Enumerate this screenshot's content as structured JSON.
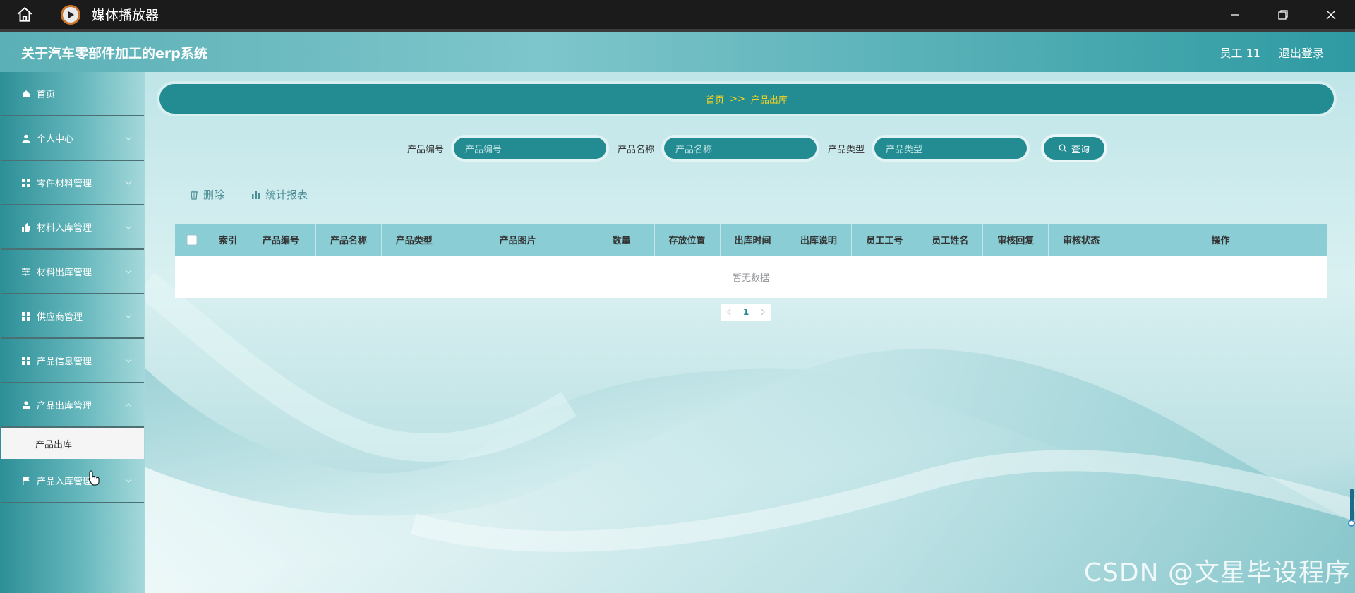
{
  "window": {
    "title": "媒体播放器"
  },
  "header": {
    "title": "关于汽车零部件加工的erp系统",
    "user": "员工 11",
    "logout": "退出登录"
  },
  "sidebar": {
    "items": [
      {
        "label": "首页",
        "icon": "home-icon",
        "has_chevron": false
      },
      {
        "label": "个人中心",
        "icon": "user-icon",
        "has_chevron": true
      },
      {
        "label": "零件材料管理",
        "icon": "grid-icon",
        "has_chevron": true
      },
      {
        "label": "材料入库管理",
        "icon": "thumb-icon",
        "has_chevron": true
      },
      {
        "label": "材料出库管理",
        "icon": "sliders-icon",
        "has_chevron": true
      },
      {
        "label": "供应商管理",
        "icon": "grid-icon",
        "has_chevron": true
      },
      {
        "label": "产品信息管理",
        "icon": "grid-icon",
        "has_chevron": true
      },
      {
        "label": "产品出库管理",
        "icon": "person-icon",
        "has_chevron": true
      },
      {
        "label": "产品入库管理",
        "icon": "flag-icon",
        "has_chevron": true
      }
    ],
    "submenu": {
      "label": "产品出库"
    }
  },
  "breadcrumb": {
    "home": "首页",
    "sep": ">>",
    "current": "产品出库"
  },
  "search": {
    "fields": [
      {
        "label": "产品编号",
        "placeholder": "产品编号"
      },
      {
        "label": "产品名称",
        "placeholder": "产品名称"
      },
      {
        "label": "产品类型",
        "placeholder": "产品类型"
      }
    ],
    "button": "查询"
  },
  "actions": {
    "delete": "删除",
    "report": "统计报表"
  },
  "table": {
    "columns": [
      "索引",
      "产品编号",
      "产品名称",
      "产品类型",
      "产品图片",
      "数量",
      "存放位置",
      "出库时间",
      "出库说明",
      "员工工号",
      "员工姓名",
      "审核回复",
      "审核状态",
      "操作"
    ],
    "empty_text": "暂无数据"
  },
  "pagination": {
    "current": "1"
  },
  "watermark": "CSDN @文星毕设程序",
  "colors": {
    "accent": "#238c92",
    "breadcrumb_text": "#f7d31f",
    "header_bg": "#1b1b1b"
  }
}
